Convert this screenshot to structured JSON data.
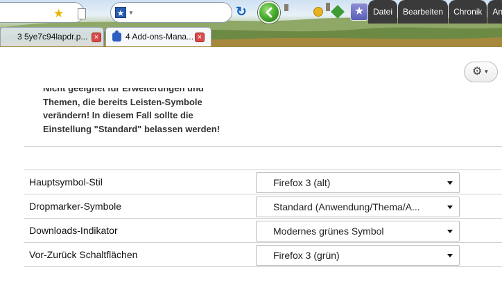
{
  "menubar": {
    "items": [
      "Datei",
      "Bearbeiten",
      "Chronik",
      "An"
    ]
  },
  "tabs": [
    {
      "label": "3 5ye7c94lapdr.p...",
      "active": false
    },
    {
      "label": "4 Add-ons-Mana...",
      "active": true
    }
  ],
  "colors": {
    "back_button": "#4caf2f",
    "tab_close": "#d94a4a",
    "menubar_bg": "#3a3a3a"
  },
  "icons": {
    "bookmark_star": "★",
    "search_engine": "★",
    "reload": "↻",
    "bookmarks_menu": "★",
    "gear": "⚙",
    "close": "×"
  },
  "settings": {
    "warning_lines": [
      "Nicht geeignet für Erweiterungen und",
      "Themen, die bereits Leisten-Symbole",
      "verändern! In diesem Fall sollte die",
      "Einstellung \"Standard\" belassen werden!"
    ],
    "rows": [
      {
        "label": "Hauptsymbol-Stil",
        "value": "Firefox 3 (alt)"
      },
      {
        "label": "Dropmarker-Symbole",
        "value": "Standard (Anwendung/Thema/A..."
      },
      {
        "label": "Downloads-Indikator",
        "value": "Modernes grünes Symbol"
      },
      {
        "label": "Vor-Zurück Schaltflächen",
        "value": "Firefox 3 (grün)"
      }
    ]
  }
}
